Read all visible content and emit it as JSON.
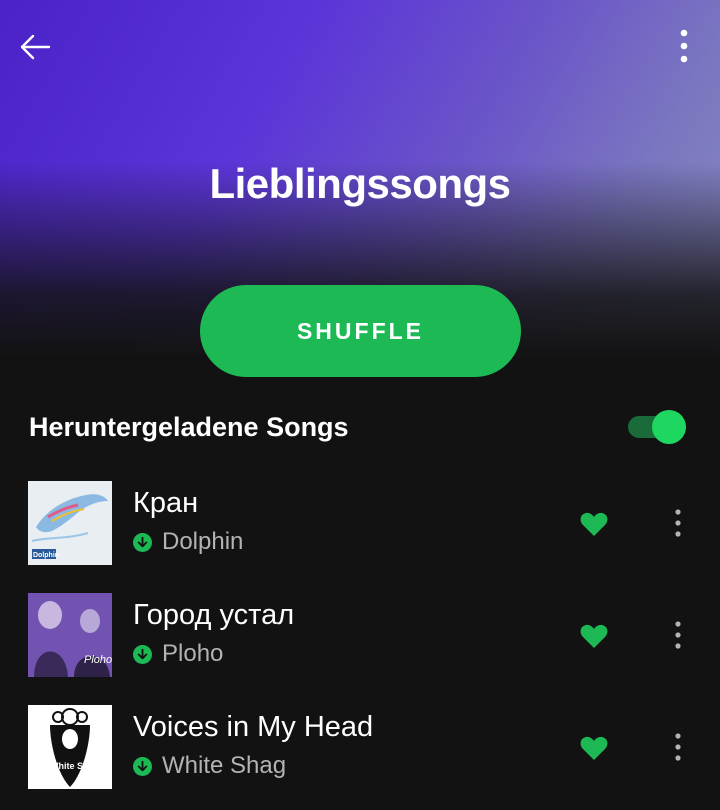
{
  "playlist": {
    "title": "Lieblingssongs"
  },
  "header": {
    "back_icon": "arrow-left-icon",
    "menu_icon": "more-vertical-icon"
  },
  "shuffle": {
    "label": "SHUFFLE"
  },
  "downloaded": {
    "label": "Heruntergeladene Songs",
    "enabled": true
  },
  "tracks": [
    {
      "title": "Кран",
      "artist": "Dolphin",
      "downloaded": true,
      "liked": true,
      "art_text": "Dolphin"
    },
    {
      "title": "Город устал",
      "artist": "Ploho",
      "downloaded": true,
      "liked": true,
      "art_text": "Ploho"
    },
    {
      "title": "Voices in My Head",
      "artist": "White Shag",
      "downloaded": true,
      "liked": true,
      "art_text": "White Shag"
    }
  ],
  "colors": {
    "accent": "#1db954",
    "background": "#121212",
    "secondary_text": "#b3b3b3"
  }
}
